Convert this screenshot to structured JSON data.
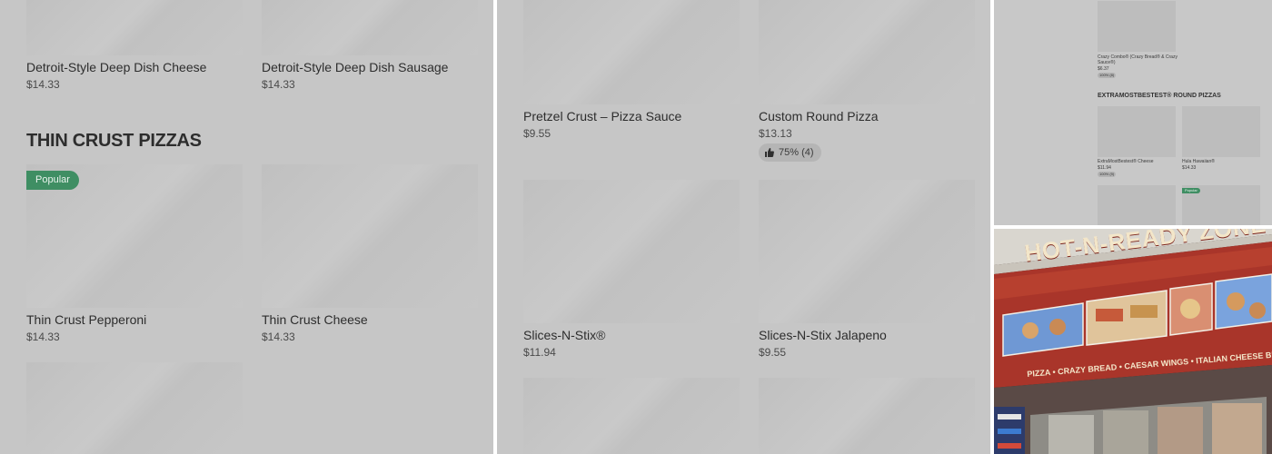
{
  "left_panel": {
    "top_items": [
      {
        "name": "Detroit-Style Deep Dish Cheese",
        "price": "$14.33"
      },
      {
        "name": "Detroit-Style Deep Dish Sausage",
        "price": "$14.33"
      }
    ],
    "section_title": "THIN CRUST PIZZAS",
    "items": [
      {
        "name": "Thin Crust Pepperoni",
        "price": "$14.33",
        "badge": "Popular"
      },
      {
        "name": "Thin Crust Cheese",
        "price": "$14.33"
      }
    ]
  },
  "middle_panel": {
    "items": [
      {
        "name": "Pretzel Crust – Pizza Sauce",
        "price": "$9.55"
      },
      {
        "name": "Custom Round Pizza",
        "price": "$13.13",
        "rating": "75% (4)"
      },
      {
        "name": "Slices-N-Stix®",
        "price": "$11.94"
      },
      {
        "name": "Slices-N-Stix Jalapeno",
        "price": "$9.55"
      }
    ]
  },
  "mini_panel": {
    "top_item": {
      "name": "Crazy Combo® (Crazy Bread® & Crazy Sauce®)",
      "price": "$6.37",
      "rating": "100% (8)"
    },
    "section_title": "EXTRAMOSTBESTEST® ROUND PIZZAS",
    "items": [
      {
        "name": "ExtraMostBestest® Cheese",
        "price": "$11.94",
        "rating": "100% (9)"
      },
      {
        "name": "Hula Hawaiian®",
        "price": "$14.33"
      }
    ],
    "badge": "Popular"
  },
  "photo": {
    "sign": "HOT-N-READY ZONE",
    "subsign": "PIZZA • CRAZY BREAD • CAESAR WINGS • ITALIAN CHEESE BREAD",
    "colors": {
      "wall": "#b23a2a",
      "sign_text": "#f3e6c9",
      "screen": "#6b9be0"
    }
  }
}
